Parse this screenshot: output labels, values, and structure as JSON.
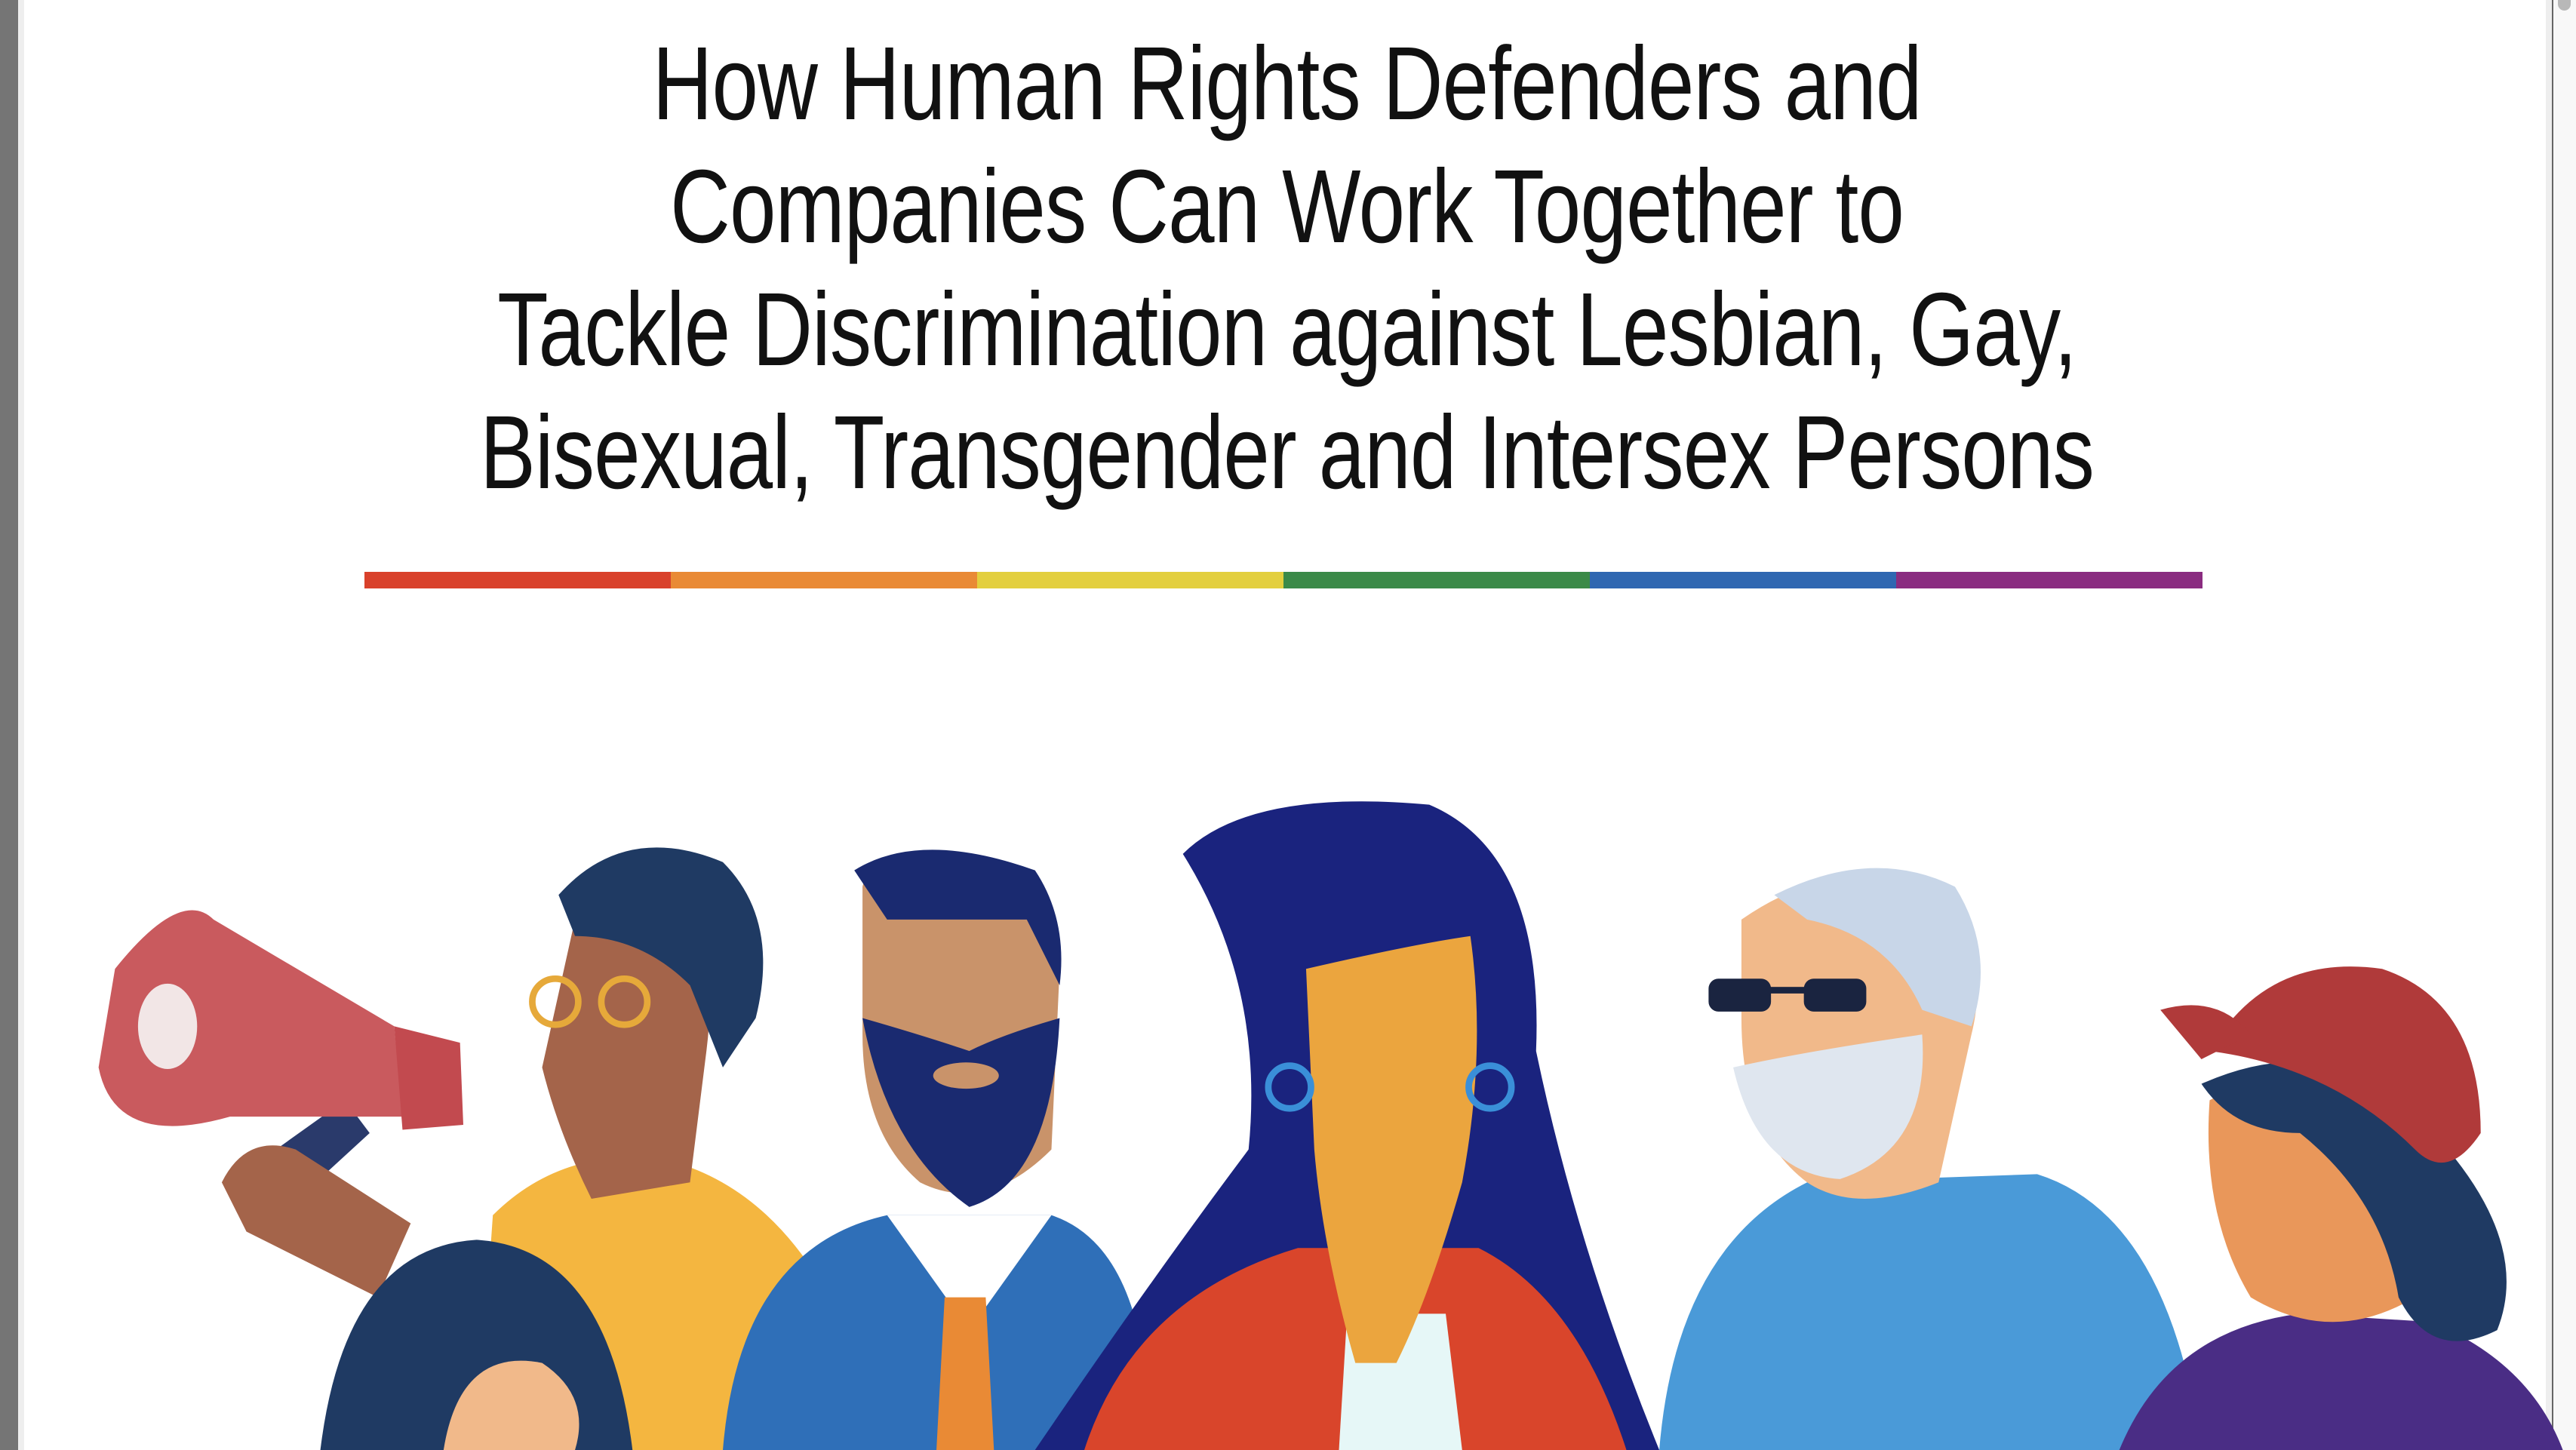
{
  "document": {
    "title_lines": [
      "How Human Rights Defenders and",
      "Companies Can Work Together to",
      "Tackle Discrimination against Lesbian, Gay,",
      "Bisexual, Transgender and Intersex Persons"
    ],
    "rainbow_colors": [
      "#d9412b",
      "#e98a35",
      "#e3cf3e",
      "#3b8a48",
      "#2f67b1",
      "#8a2c80"
    ]
  }
}
